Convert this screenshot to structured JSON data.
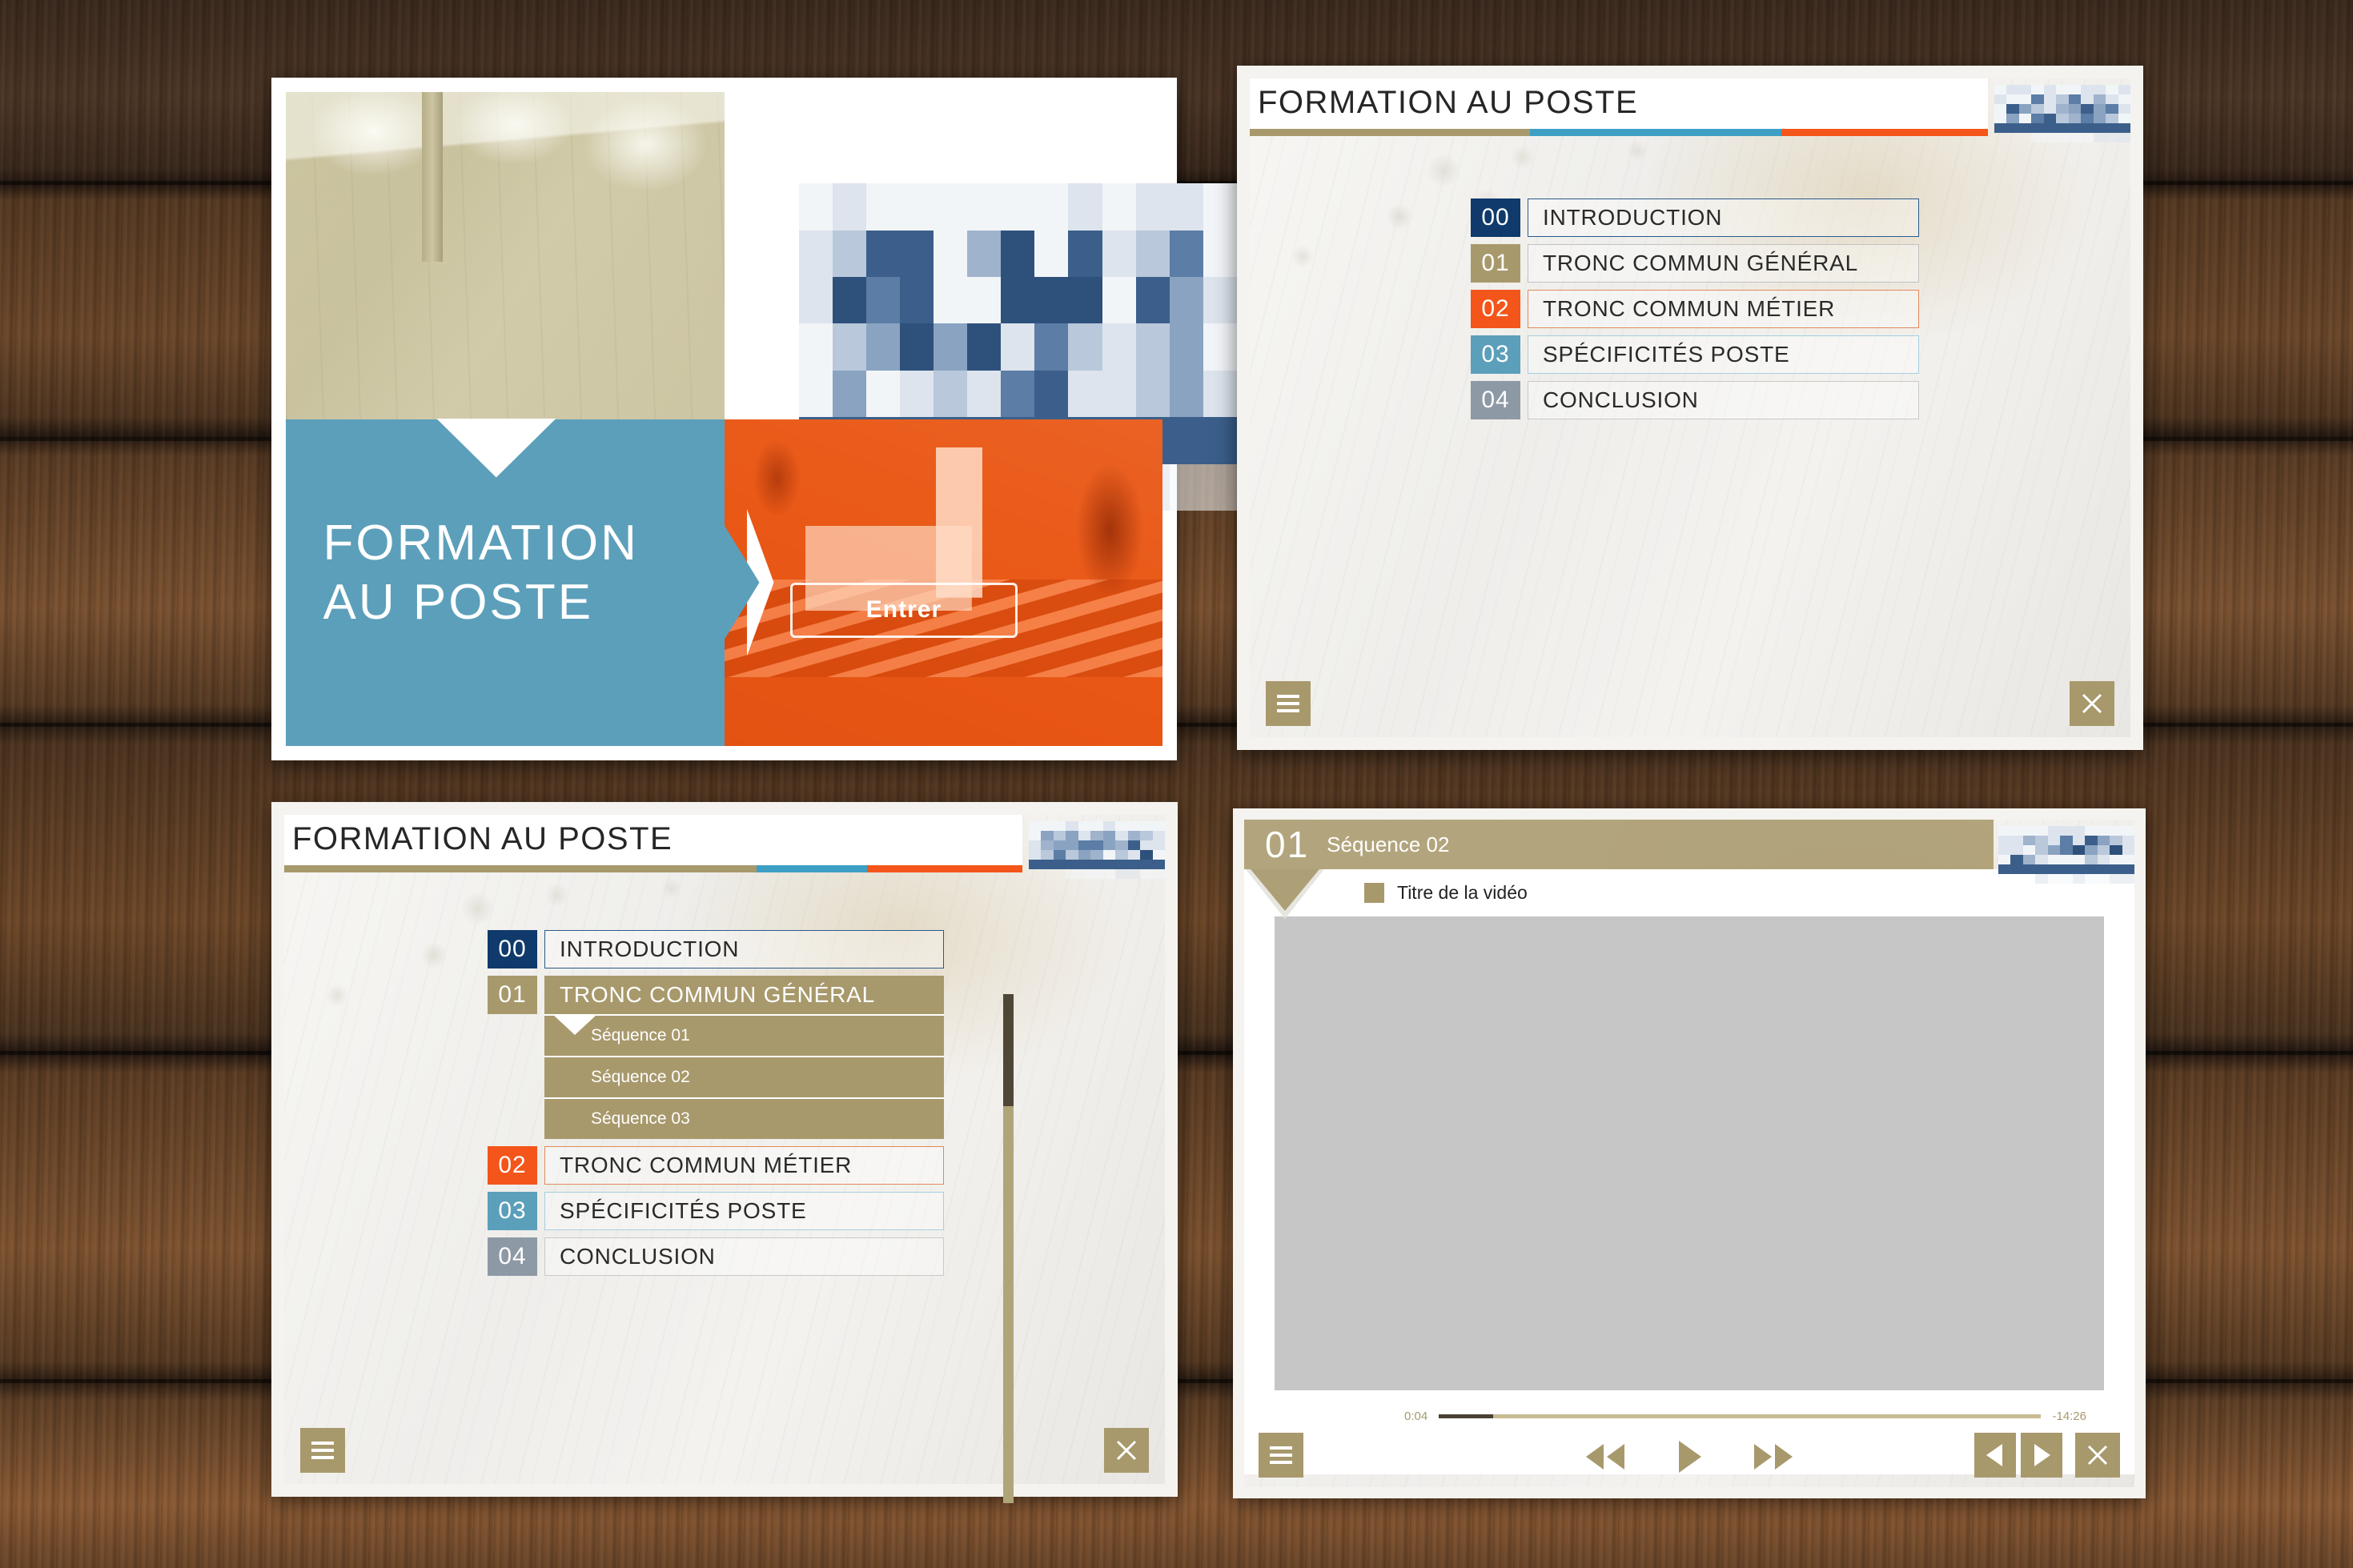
{
  "colors": {
    "khaki": "#a8996c",
    "blue": "#5c9fba",
    "orange": "#f4551a",
    "navy": "#0f3a6b",
    "gray": "#8d99a5",
    "white": "#ffffff",
    "video_placeholder": "#c6c6c6",
    "scrollbar_thumb": "#4f4735",
    "progress_fill": "#4a4232"
  },
  "cover": {
    "title_line1": "FORMATION",
    "title_line2": "AU POSTE",
    "enter_button": "Entrer",
    "logo_alt": "redacted-company-logo",
    "photo_office_alt": "office-chairs-photo",
    "photo_plant_alt": "industrial-plant-photo"
  },
  "menu_slide": {
    "header_title": "FORMATION AU POSTE",
    "logo_alt": "redacted-company-logo",
    "progress_segments": [
      {
        "color": "#a8996c",
        "width_pct": 38
      },
      {
        "color": "#3e9fc4",
        "width_pct": 34
      },
      {
        "color": "#f4551a",
        "width_pct": 28
      }
    ],
    "items": [
      {
        "num": "00",
        "label": "INTRODUCTION",
        "badge_color": "#0f3a6b",
        "border_color": "#2b5a8c",
        "state": "current"
      },
      {
        "num": "01",
        "label": "TRONC COMMUN GÉNÉRAL",
        "badge_color": "#a8996c",
        "border_color": "#c2c2c2",
        "state": "default"
      },
      {
        "num": "02",
        "label": "TRONC COMMUN MÉTIER",
        "badge_color": "#f4551a",
        "border_color": "#e08a5a",
        "state": "default"
      },
      {
        "num": "03",
        "label": "SPÉCIFICITÉS POSTE",
        "badge_color": "#5c9fba",
        "border_color": "#a7cede",
        "state": "default"
      },
      {
        "num": "04",
        "label": "CONCLUSION",
        "badge_color": "#8d99a5",
        "border_color": "#c9c9c9",
        "state": "default"
      }
    ],
    "menu_button_icon": "hamburger-icon",
    "close_button_icon": "close-icon"
  },
  "expanded_slide": {
    "header_title": "FORMATION AU POSTE",
    "logo_alt": "redacted-company-logo",
    "progress_segments": [
      {
        "color": "#a8996c",
        "width_pct": 64
      },
      {
        "color": "#3e9fc4",
        "width_pct": 15
      },
      {
        "color": "#f4551a",
        "width_pct": 21
      }
    ],
    "items": [
      {
        "num": "00",
        "label": "INTRODUCTION",
        "badge_color": "#0f3a6b",
        "border_color": "#2b5a8c",
        "state": "default",
        "subitems": []
      },
      {
        "num": "01",
        "label": "TRONC COMMUN GÉNÉRAL",
        "badge_color": "#a8996c",
        "border_color": "#a8996c",
        "state": "expanded",
        "subitems": [
          "Séquence 01",
          "Séquence 02",
          "Séquence 03"
        ]
      },
      {
        "num": "02",
        "label": "TRONC COMMUN MÉTIER",
        "badge_color": "#f4551a",
        "border_color": "#e08a5a",
        "state": "default",
        "subitems": []
      },
      {
        "num": "03",
        "label": "SPÉCIFICITÉS POSTE",
        "badge_color": "#5c9fba",
        "border_color": "#a7cede",
        "state": "default",
        "subitems": []
      },
      {
        "num": "04",
        "label": "CONCLUSION",
        "badge_color": "#8d99a5",
        "border_color": "#c9c9c9",
        "state": "default",
        "subitems": []
      }
    ],
    "scrollbar": {
      "thumb_position_pct": 0,
      "thumb_size_pct": 22
    },
    "menu_button_icon": "hamburger-icon",
    "close_button_icon": "close-icon"
  },
  "video_slide": {
    "chapter_num": "01",
    "sequence_label": "Séquence 02",
    "logo_alt": "redacted-company-logo",
    "video_title": "Titre de la vidéo",
    "player": {
      "elapsed": "0:04",
      "remaining": "-14:26",
      "progress_pct": 9,
      "rewind_icon": "rewind-icon",
      "play_icon": "play-icon",
      "forward_icon": "fast-forward-icon"
    },
    "menu_button_icon": "hamburger-icon",
    "prev_button_icon": "previous-icon",
    "next_button_icon": "next-icon",
    "close_button_icon": "close-icon"
  }
}
